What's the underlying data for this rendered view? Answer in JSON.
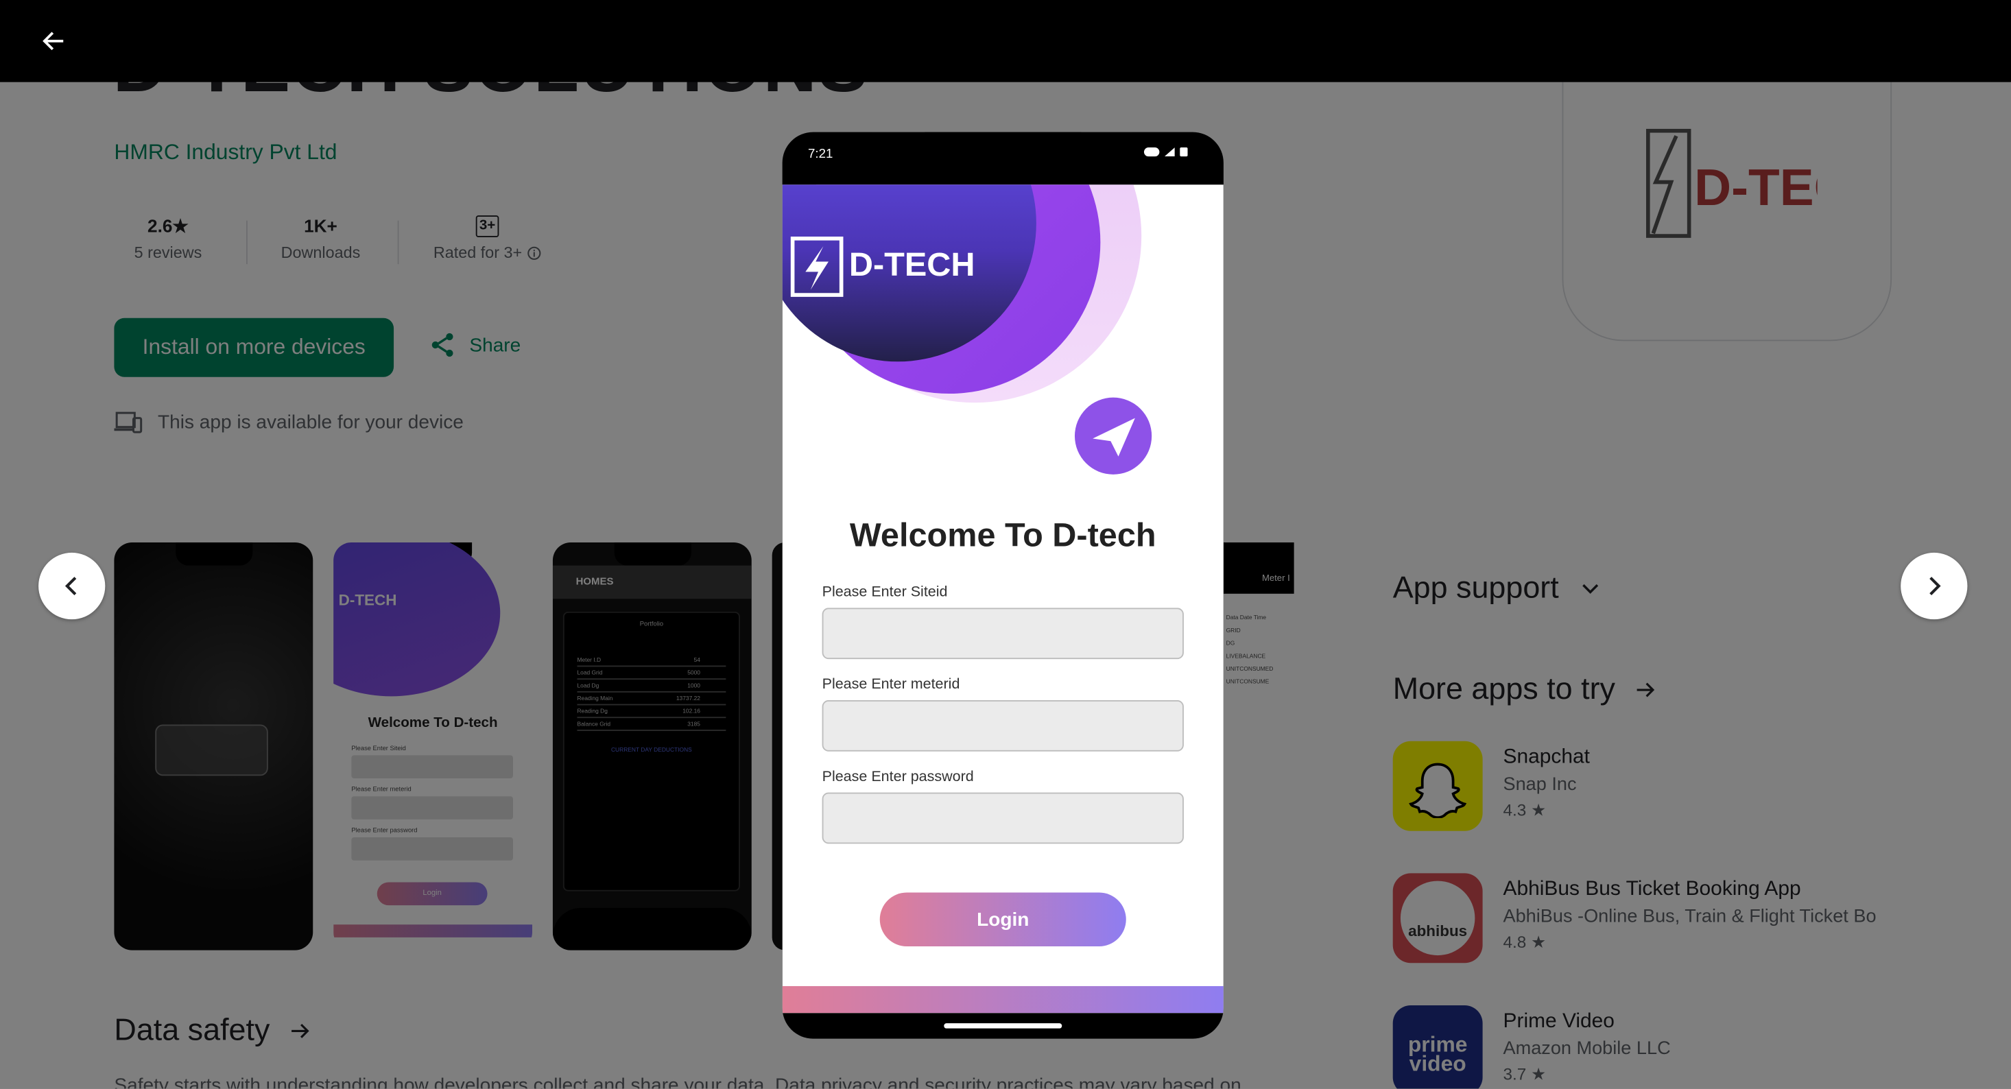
{
  "app": {
    "title_partial": "D-TECH SOLUTIONS",
    "developer": "HMRC Industry Pvt Ltd",
    "stats": [
      {
        "value": "2.6★",
        "label": "5 reviews"
      },
      {
        "value": "1K+",
        "label": "Downloads"
      },
      {
        "value": "3+",
        "label": "Rated for 3+"
      }
    ],
    "install_label": "Install on more devices",
    "share_label": "Share",
    "availability": "This app is available for your device",
    "icon_logo_text": "D-TECH"
  },
  "sections": {
    "data_safety": "Data safety",
    "data_safety_sub": "Safety starts with understanding how developers collect and share your data. Data privacy and security practices may vary based on",
    "app_support": "App support",
    "more_apps": "More apps to try"
  },
  "more_apps": [
    {
      "name": "Snapchat",
      "developer": "Snap Inc",
      "rating": "4.3 ★"
    },
    {
      "name": "AbhiBus Bus Ticket Booking App",
      "developer": "AbhiBus -Online Bus, Train & Flight Ticket Bo",
      "rating": "4.8 ★",
      "icon_text": "abhibus"
    },
    {
      "name": "Prime Video",
      "developer": "Amazon Mobile LLC",
      "rating": "3.7 ★",
      "icon_text_1": "prime",
      "icon_text_2": "video"
    }
  ],
  "thumbs": {
    "t2_brand": "D-TECH",
    "t2_welcome": "Welcome To D-tech",
    "t2_fields": [
      "Please Enter Siteid",
      "Please Enter meterid",
      "Please Enter password"
    ],
    "t2_login": "Login",
    "t3_header": "HOMES",
    "t3_card_title": "Portfolio",
    "t3_rows": [
      "Meter I.D",
      "Load Grid",
      "Load Dg",
      "Reading Main",
      "Reading Dg",
      "Balance Grid"
    ],
    "t3_values": [
      "54",
      "5000",
      "1000",
      "13737.22",
      "102.16",
      "3185"
    ],
    "t3_section": "CURRENT DAY DEDUCTIONS",
    "t5_header": "Meter I",
    "t5_lines": [
      "Data Date Time",
      "GRID",
      "DG",
      "LIVEBALANCE",
      "UNITCONSUMED",
      "UNITCONSUME"
    ]
  },
  "phone": {
    "time": "7:21",
    "brand": "D-TECH",
    "welcome": "Welcome To D-tech",
    "fields": [
      {
        "label": "Please Enter Siteid",
        "value": ""
      },
      {
        "label": "Please Enter meterid",
        "value": ""
      },
      {
        "label": "Please Enter password",
        "value": ""
      }
    ],
    "login_label": "Login"
  },
  "colors": {
    "accent_green": "#01875f",
    "overlay": "rgba(0,0,0,0.5)",
    "brand_purple": "#6a4cf0",
    "login_start": "#e07e97",
    "login_end": "#8f7df0"
  }
}
